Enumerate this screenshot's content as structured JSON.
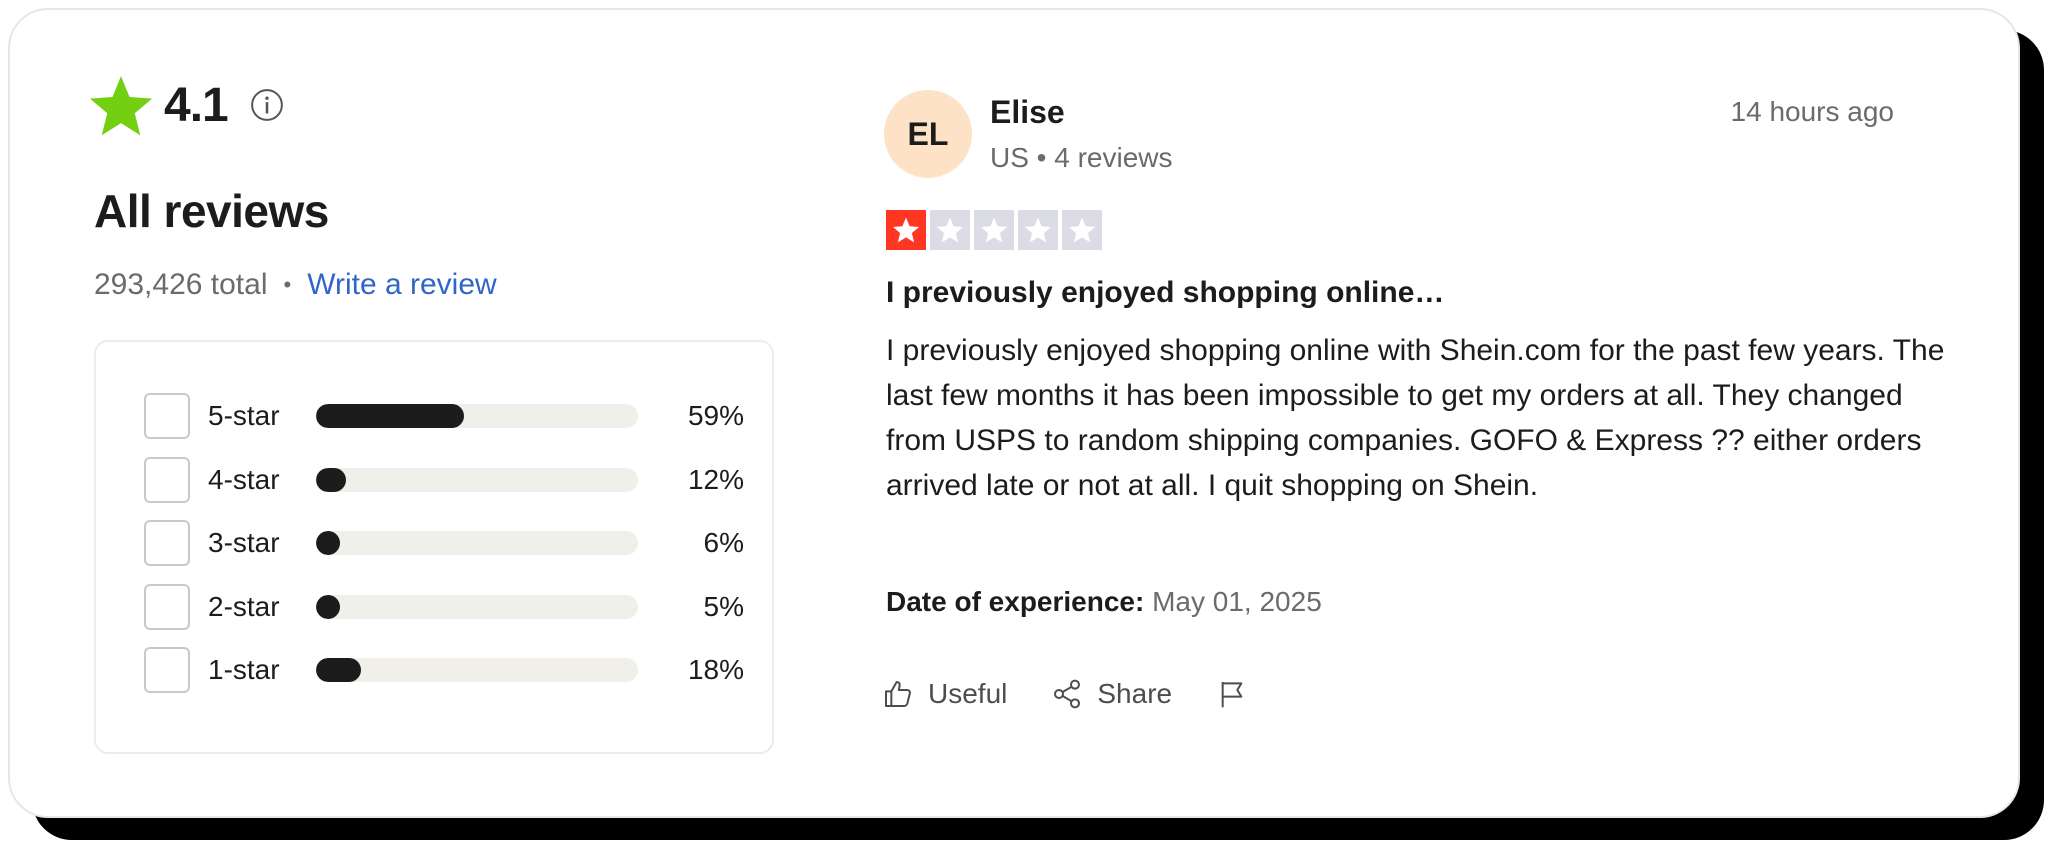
{
  "summary": {
    "rating": "4.1",
    "star_color": "#73cf11",
    "heading": "All reviews",
    "total": "293,426 total",
    "separator": "•",
    "write_review": "Write a review"
  },
  "distribution": [
    {
      "label": "5-star",
      "percent_text": "59%",
      "value": 59
    },
    {
      "label": "4-star",
      "percent_text": "12%",
      "value": 12
    },
    {
      "label": "3-star",
      "percent_text": "6%",
      "value": 6
    },
    {
      "label": "2-star",
      "percent_text": "5%",
      "value": 5
    },
    {
      "label": "1-star",
      "percent_text": "18%",
      "value": 18
    }
  ],
  "review": {
    "avatar_initials": "EL",
    "name": "Elise",
    "meta": "US • 4 reviews",
    "time": "14 hours ago",
    "stars": 1,
    "star_color": "#ff3722",
    "title": "I previously enjoyed shopping online…",
    "body": "I previously enjoyed shopping online with Shein.com for the past few years. The last few months it has been impossible to get my orders at all. They changed from USPS to random shipping companies. GOFO & Express ?? either orders arrived late or not at all. I quit shopping on Shein.",
    "date_label": "Date of experience:",
    "date_value": "May 01, 2025",
    "actions": {
      "useful": "Useful",
      "share": "Share"
    }
  }
}
